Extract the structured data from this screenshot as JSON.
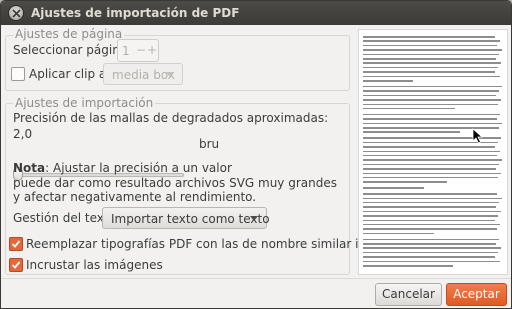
{
  "window": {
    "title": "Ajustes de importación de PDF"
  },
  "page_settings": {
    "section_title": "Ajustes de página",
    "select_page_label": "Seleccionar página",
    "page_value": "1",
    "spin_minus": "−",
    "spin_plus": "+",
    "clip_label": "Aplicar clip a:",
    "clip_checked": false,
    "clip_option": "media box"
  },
  "import_settings": {
    "section_title": "Ajustes de importación",
    "precision_label": "Precisión de las mallas de degradados aproximadas:",
    "precision_value": "2,0",
    "precision_fraction": 0.02,
    "precision_quality": "bru",
    "note_bold": "Nota",
    "note_rest": ": Ajustar la precisión a un valor",
    "note_line2": "puede dar como resultado archivos SVG muy grandes",
    "note_line3": "y afectar negativamente al rendimiento.",
    "text_handling_label": "Gestión del texto:",
    "text_handling_option": "Importar texto como texto",
    "replace_fonts_label": "Reemplazar tipografías PDF con las de nombre similar instaladas",
    "replace_fonts_checked": true,
    "embed_images_label": "Incrustar las imágenes",
    "embed_images_checked": true
  },
  "buttons": {
    "cancel": "Cancelar",
    "accept": "Aceptar"
  },
  "colors": {
    "accent": "#e5673a",
    "titlebar": "#3c3b37",
    "background": "#f2f1f0"
  },
  "icons": [
    "close-icon",
    "check-icon",
    "chevron-down-icon",
    "pointer-cursor-icon"
  ]
}
